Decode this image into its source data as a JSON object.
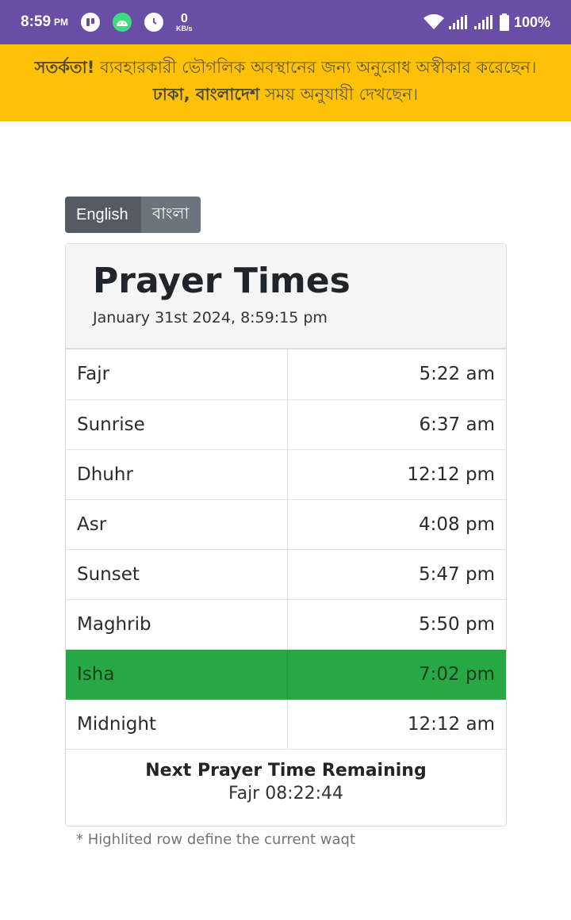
{
  "status_bar": {
    "time": "8:59",
    "ampm": "PM",
    "net_speed_value": "0",
    "net_speed_unit": "KB/s",
    "battery": "100%"
  },
  "alert": {
    "strong": "সতর্কতা!",
    "text_1": " ব্যবহারকারী ভৌগলিক অবস্থানের জন্য অনুরোধ অস্বীকার করেছেন। ",
    "location": "ঢাকা, বাংলাদেশ",
    "text_2": " সময় অনুযায়ী দেখছেন।"
  },
  "language": {
    "english": "English",
    "bangla": "বাংলা"
  },
  "card": {
    "title": "Prayer Times",
    "datetime": "January 31st 2024, 8:59:15 pm"
  },
  "times": [
    {
      "name": "Fajr",
      "time": "5:22 am"
    },
    {
      "name": "Sunrise",
      "time": "6:37 am"
    },
    {
      "name": "Dhuhr",
      "time": "12:12 pm"
    },
    {
      "name": "Asr",
      "time": "4:08 pm"
    },
    {
      "name": "Sunset",
      "time": "5:47 pm"
    },
    {
      "name": "Maghrib",
      "time": "5:50 pm"
    },
    {
      "name": "Isha",
      "time": "7:02 pm"
    },
    {
      "name": "Midnight",
      "time": "12:12 am"
    }
  ],
  "next_prayer": {
    "title": "Next Prayer Time Remaining",
    "value": "Fajr 08:22:44"
  },
  "footnote": "* Highlited row define the current waqt",
  "colors": {
    "status_bar": "#6a4ea6",
    "alert": "#ffc107",
    "active_row": "#28a745"
  }
}
